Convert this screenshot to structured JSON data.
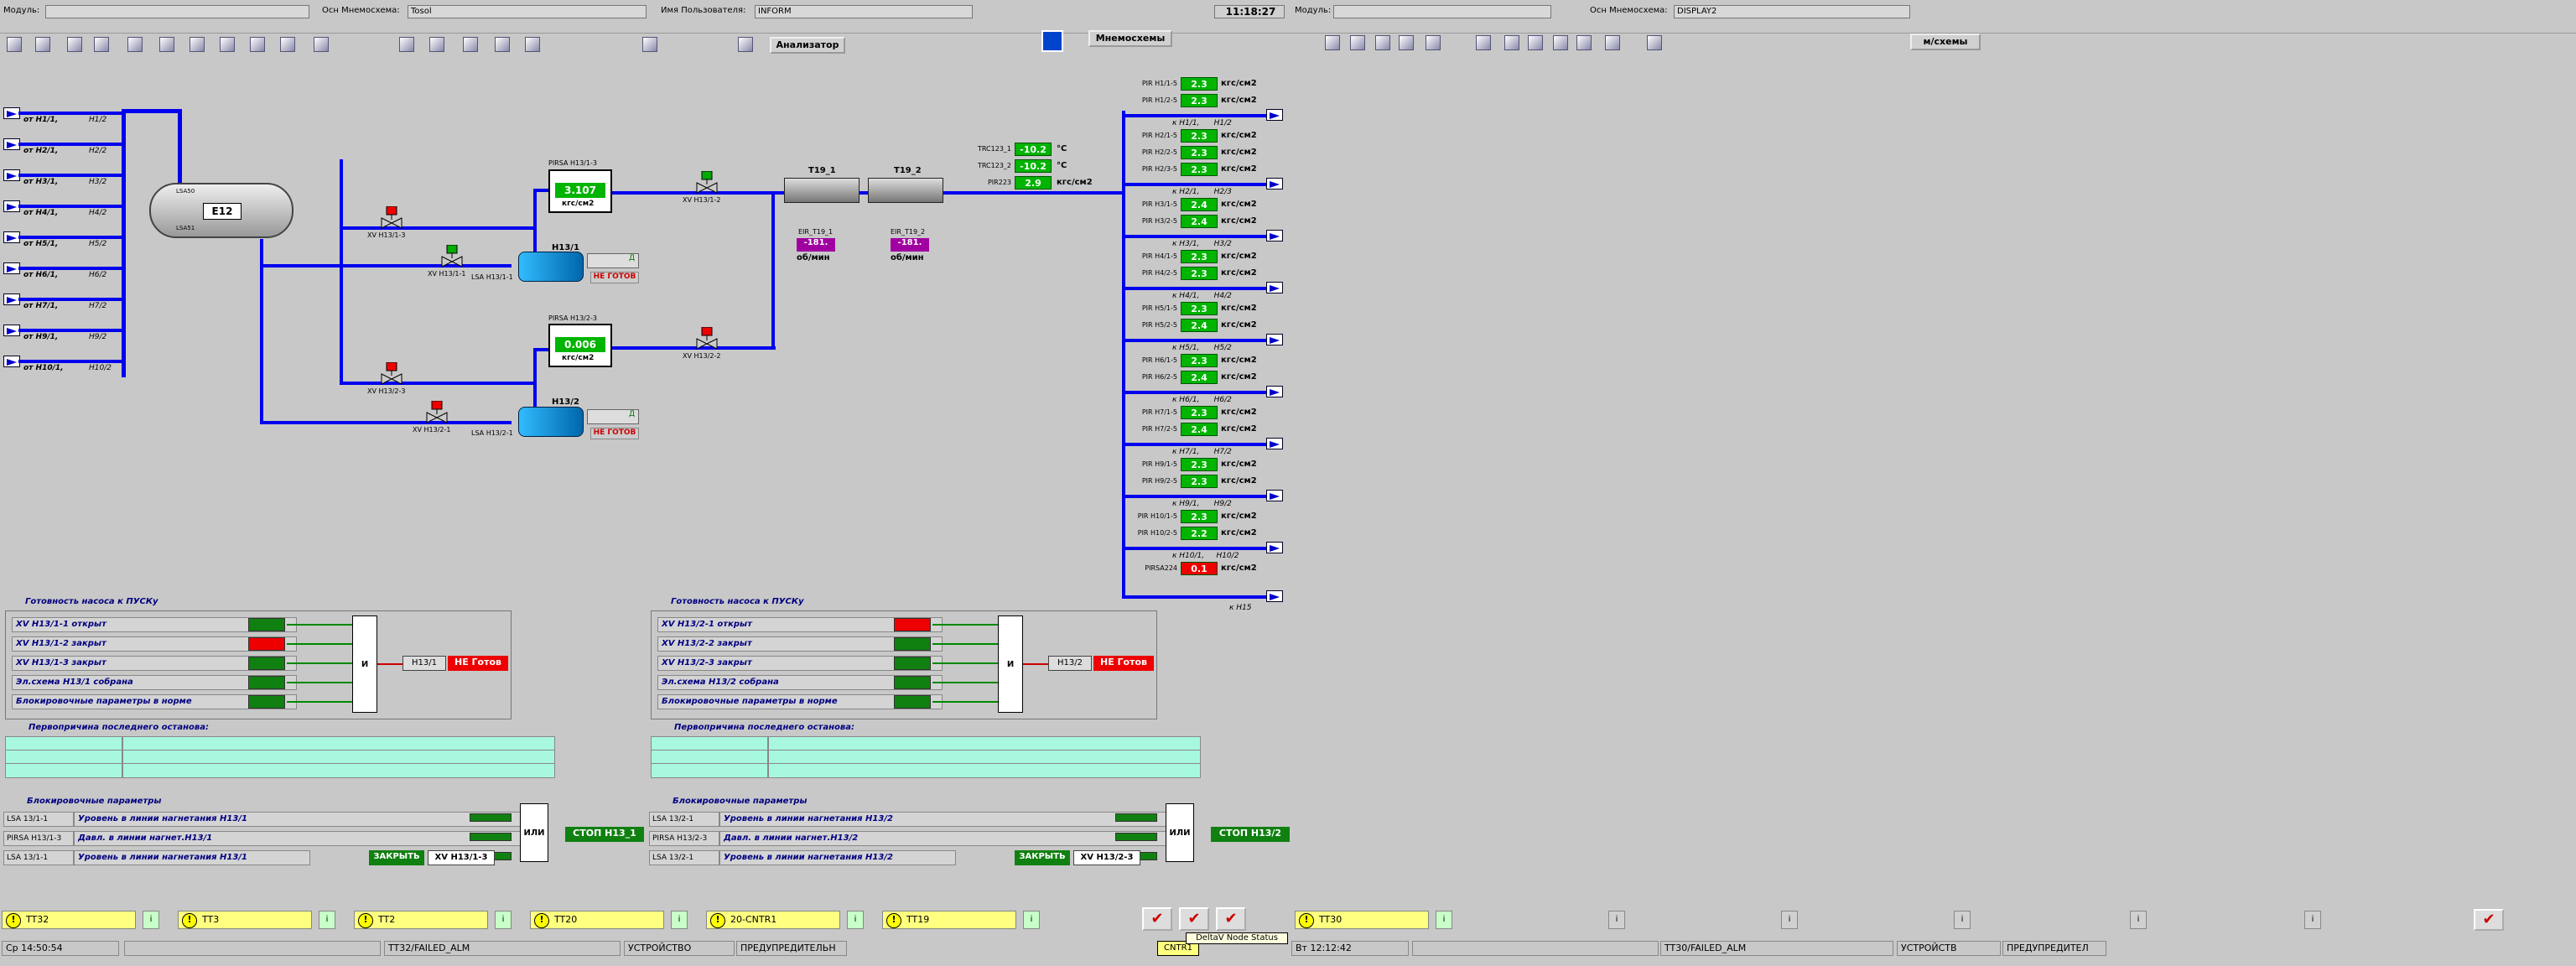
{
  "header_left": {
    "modul_label": "Модуль:",
    "on_mnem_label": "Осн Мнемосхема:",
    "on_mnem_value": "Tosol",
    "user_label": "Имя Пользователя:",
    "user_value": "INFORM",
    "analyzer_btn": "Анализатор",
    "time": "11:18:27",
    "mnem_btn": "Мнемосхемы"
  },
  "header_right": {
    "modul_label": "Модуль:",
    "on_mnem_label": "Осн Мнемосхема:",
    "on_mnem_value": "DISPLAY2",
    "mnem_btn": "м/схемы"
  },
  "sources": [
    [
      "от Н1/1,",
      "Н1/2"
    ],
    [
      "от Н2/1,",
      "Н2/2"
    ],
    [
      "от Н3/1,",
      "Н3/2"
    ],
    [
      "от Н4/1,",
      "Н4/2"
    ],
    [
      "от Н5/1,",
      "Н5/2"
    ],
    [
      "от Н6/1,",
      "Н6/2"
    ],
    [
      "от Н7/1,",
      "Н7/2"
    ],
    [
      "от Н9/1,",
      "Н9/2"
    ],
    [
      "от Н10/1,",
      "Н10/2"
    ]
  ],
  "vessel": {
    "name": "Е12",
    "lsa_top": "LSA50",
    "lsa_bot": "LSA51"
  },
  "valves": {
    "xv1": "XV Н13/1-3",
    "xv2": "XV Н13/1-1",
    "xv3": "XV Н13/1-2",
    "xv4": "XV Н13/2-3",
    "xv5": "XV Н13/2-1",
    "xv6": "XV Н13/2-2"
  },
  "pumps": {
    "p1": "Н13/1",
    "p1_lsa": "LSA Н13/1-1",
    "p1_status": "НЕ ГОТОВ",
    "p1_d": "Д",
    "p2": "Н13/2",
    "p2_lsa": "LSA Н13/2-1",
    "p2_status": "НЕ ГОТОВ",
    "p2_d": "Д"
  },
  "pirsa1": {
    "tag": "PIRSA Н13/1-3",
    "value": "3.107",
    "unit": "кгс/см2"
  },
  "pirsa2": {
    "tag": "PIRSA Н13/2-3",
    "value": "0.006",
    "unit": "кгс/см2"
  },
  "coolers": {
    "t1": "Т19_1",
    "t2": "Т19_2",
    "e1": "EIR_Т19_1",
    "e1v": "-181.",
    "e2": "EIR_Т19_2",
    "e2v": "-181.",
    "rpm": "об/мин"
  },
  "trc": [
    {
      "tag": "TRC123_1",
      "value": "-10.2",
      "unit": "°С"
    },
    {
      "tag": "TRC123_2",
      "value": "-10.2",
      "unit": "°С"
    },
    {
      "tag": "PIR223",
      "value": "2.9",
      "unit": "кгс/см2"
    }
  ],
  "outputs": [
    {
      "head": "",
      "r": [
        [
          "PIR Н1/1-5",
          "2.3"
        ],
        [
          "PIR Н1/2-5",
          "2.3"
        ]
      ]
    },
    {
      "head": "к Н1/1,      Н1/2",
      "r": [
        [
          "PIR Н2/1-5",
          "2.3"
        ],
        [
          "PIR Н2/2-5",
          "2.3"
        ],
        [
          "PIR Н2/3-5",
          "2.3"
        ]
      ]
    },
    {
      "head": "к Н2/1,      Н2/3",
      "r": [
        [
          "PIR Н3/1-5",
          "2.4"
        ],
        [
          "PIR Н3/2-5",
          "2.4"
        ]
      ]
    },
    {
      "head": "к Н3/1,      Н3/2",
      "r": [
        [
          "PIR Н4/1-5",
          "2.3"
        ],
        [
          "PIR Н4/2-5",
          "2.3"
        ]
      ]
    },
    {
      "head": "к Н4/1,      Н4/2",
      "r": [
        [
          "PIR Н5/1-5",
          "2.3"
        ],
        [
          "PIR Н5/2-5",
          "2.4"
        ]
      ]
    },
    {
      "head": "к Н5/1,      Н5/2",
      "r": [
        [
          "PIR Н6/1-5",
          "2.3"
        ],
        [
          "PIR Н6/2-5",
          "2.4"
        ]
      ]
    },
    {
      "head": "к Н6/1,      Н6/2",
      "r": [
        [
          "PIR Н7/1-5",
          "2.3"
        ],
        [
          "PIR Н7/2-5",
          "2.4"
        ]
      ]
    },
    {
      "head": "к Н7/1,      Н7/2",
      "r": [
        [
          "PIR Н9/1-5",
          "2.3"
        ],
        [
          "PIR Н9/2-5",
          "2.3"
        ]
      ]
    },
    {
      "head": "к Н9/1,      Н9/2",
      "r": [
        [
          "PIR Н10/1-5",
          "2.3"
        ],
        [
          "PIR Н10/2-5",
          "2.2"
        ]
      ]
    },
    {
      "head": "к Н10/1,     Н10/2",
      "r": [
        [
          "PIRSA224",
          "0.1"
        ]
      ]
    }
  ],
  "out_unit": "кгс/см2",
  "out_last": "к Н15",
  "ready1": {
    "title": "Готовность насоса к ПУСКу",
    "rows": [
      "XV Н13/1-1 открыт",
      "XV Н13/1-2 закрыт",
      "XV Н13/1-3 закрыт",
      "Эл.схема Н13/1 собрана",
      "Блокировочные параметры в норме"
    ],
    "and": "И",
    "pump": "Н13/1",
    "status": "НЕ Готов"
  },
  "ready2": {
    "title": "Готовность насоса к ПУСКу",
    "rows": [
      "XV Н13/2-1 открыт",
      "XV Н13/2-2 закрыт",
      "XV Н13/2-3 закрыт",
      "Эл.схема Н13/2 собрана",
      "Блокировочные параметры в норме"
    ],
    "and": "И",
    "pump": "Н13/2",
    "status": "НЕ Готов"
  },
  "first1": "Первопричина последнего останова:",
  "first2": "Первопричина последнего останова:",
  "block1": {
    "title": "Блокировочные параметры",
    "rows": [
      [
        "LSA 13/1-1",
        "Уровень в линии нагнетания Н13/1"
      ],
      [
        "PIRSA Н13/1-3",
        "Давл. в линии нагнет.Н13/1"
      ],
      [
        "LSA 13/1-1",
        "Уровень в линии нагнетания Н13/1"
      ]
    ],
    "or": "ИЛИ",
    "stop": "СТОП Н13_1",
    "close": "ЗАКРЫТЬ",
    "xv": "XV Н13/1-3"
  },
  "block2": {
    "title": "Блокировочные параметры",
    "rows": [
      [
        "LSA 13/2-1",
        "Уровень в линии нагнетания Н13/2"
      ],
      [
        "PIRSA Н13/2-3",
        "Давл. в линии нагнет.Н13/2"
      ],
      [
        "LSA 13/2-1",
        "Уровень в линии нагнетания Н13/2"
      ]
    ],
    "or": "ИЛИ",
    "stop": "СТОП Н13/2",
    "close": "ЗАКРЫТЬ",
    "xv": "XV Н13/2-3"
  },
  "alarms_left": [
    "TT32",
    "TT3",
    "TT2",
    "TT20",
    "20-CNTR1",
    "TT19"
  ],
  "alarms_right": [
    "TT30"
  ],
  "status_left": {
    "time": "Ср 14:50:54",
    "alm": "TT32/FAILED_ALM",
    "dev": "УСТРОЙСТВО",
    "warn": "ПРЕДУПРЕДИТЕЛЬН"
  },
  "status_mid": {
    "cntr": "CNTR1",
    "tooltip": "DeltaV Node Status"
  },
  "status_right": {
    "time": "Вт 12:12:42",
    "alm": "TT30/FAILED_ALM",
    "dev": "УСТРОЙСТВ",
    "warn": "ПРЕДУПРЕДИТЕЛ"
  }
}
